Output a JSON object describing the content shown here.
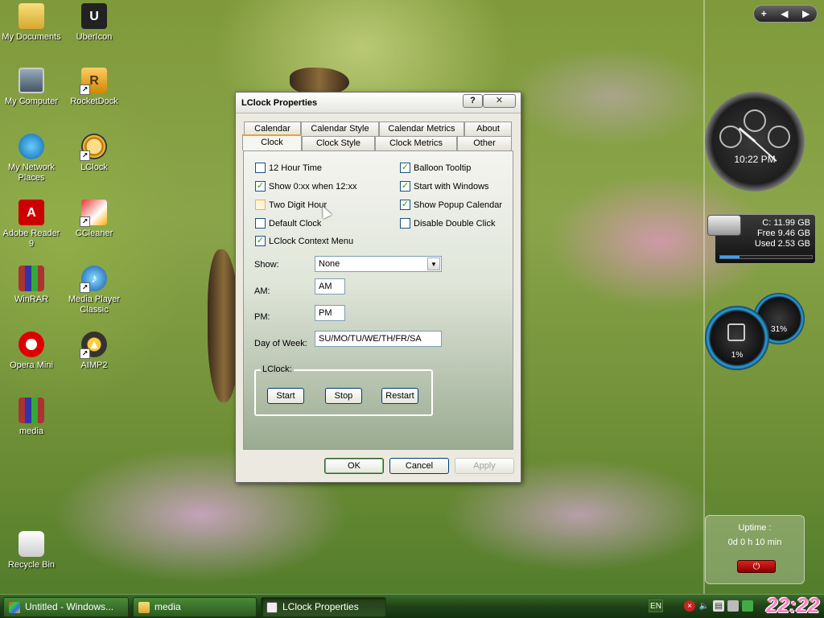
{
  "desktop": {
    "icons": [
      {
        "label": "My Documents"
      },
      {
        "label": "UberIcon"
      },
      {
        "label": "My Computer"
      },
      {
        "label": "RocketDock"
      },
      {
        "label": "My Network Places"
      },
      {
        "label": "LClock"
      },
      {
        "label": "Adobe Reader 9"
      },
      {
        "label": "CCleaner"
      },
      {
        "label": "WinRAR"
      },
      {
        "label": "Media Player Classic"
      },
      {
        "label": "Opera Mini"
      },
      {
        "label": "AIMP2"
      },
      {
        "label": "media"
      },
      {
        "label": "Recycle Bin"
      }
    ]
  },
  "sidebar": {
    "nav": {
      "add": "+",
      "prev": "◀",
      "next": "▶"
    },
    "clock_time": "10:22 PM",
    "drive": {
      "line1": "C:  11.99 GB",
      "line2": "Free 9.46 GB",
      "line3": "Used 2.53 GB",
      "used_fraction": 0.21
    },
    "cpu_meter": "1%",
    "mem_meter": "31%",
    "uptime_label": "Uptime :",
    "uptime_value": "0d 0 h 10 min"
  },
  "dialog": {
    "title": "LClock Properties",
    "help_btn": "?",
    "close_btn": "✕",
    "tabs_back": [
      "Calendar",
      "Calendar Style",
      "Calendar Metrics",
      "About"
    ],
    "tabs_front": [
      "Clock",
      "Clock Style",
      "Clock Metrics",
      "Other"
    ],
    "options_left": [
      {
        "label": "12 Hour Time",
        "checked": false
      },
      {
        "label": "Show 0:xx when 12:xx",
        "checked": true
      },
      {
        "label": "Two Digit Hour",
        "checked": false
      },
      {
        "label": "Default Clock",
        "checked": false
      },
      {
        "label": "LClock Context Menu",
        "checked": true
      }
    ],
    "options_right": [
      {
        "label": "Balloon Tooltip",
        "checked": true
      },
      {
        "label": "Start with Windows",
        "checked": true
      },
      {
        "label": "Show Popup Calendar",
        "checked": true
      },
      {
        "label": "Disable Double Click",
        "checked": false
      }
    ],
    "show_label": "Show:",
    "show_value": "None",
    "am_label": "AM:",
    "am_value": "AM",
    "pm_label": "PM:",
    "pm_value": "PM",
    "dow_label": "Day of Week:",
    "dow_value": "SU/MO/TU/WE/TH/FR/SA",
    "group_label": "LClock:",
    "start": "Start",
    "stop": "Stop",
    "restart": "Restart",
    "ok": "OK",
    "cancel": "Cancel",
    "apply": "Apply"
  },
  "taskbar": {
    "tasks": [
      "Untitled - Windows...",
      "media",
      "LClock Properties"
    ],
    "lang": "EN",
    "clock": "22:22"
  }
}
